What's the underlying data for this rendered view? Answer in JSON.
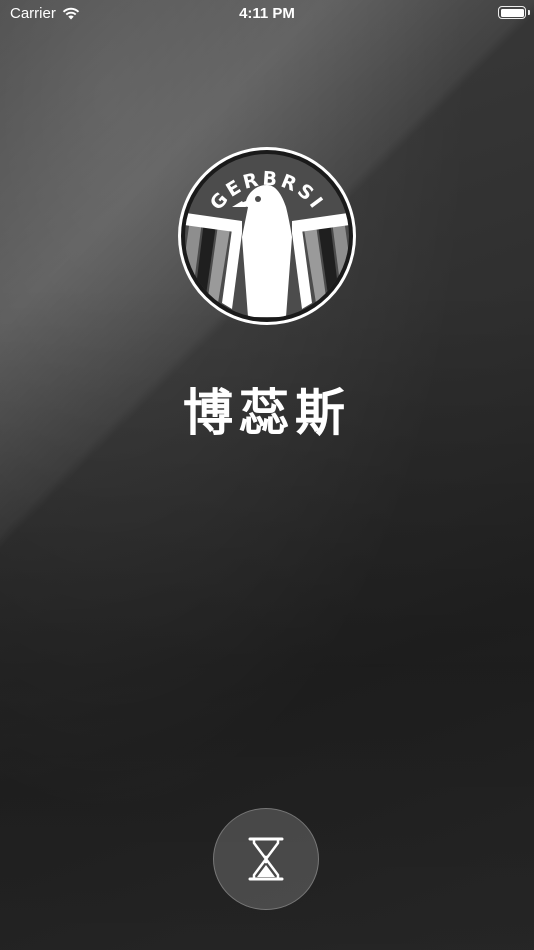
{
  "status_bar": {
    "carrier": "Carrier",
    "time": "4:11 PM",
    "wifi_icon": "wifi-icon",
    "battery_icon": "battery-icon"
  },
  "logo": {
    "text": "GERBRSI",
    "icon": "eagle-emblem-icon"
  },
  "brand": {
    "title": "博蕊斯"
  },
  "loading": {
    "icon": "hourglass-icon"
  },
  "colors": {
    "background": "#2a2a2a",
    "text": "#ffffff",
    "logo_bg": "#4a4a4a",
    "logo_stripe": "#8c8c8c"
  }
}
